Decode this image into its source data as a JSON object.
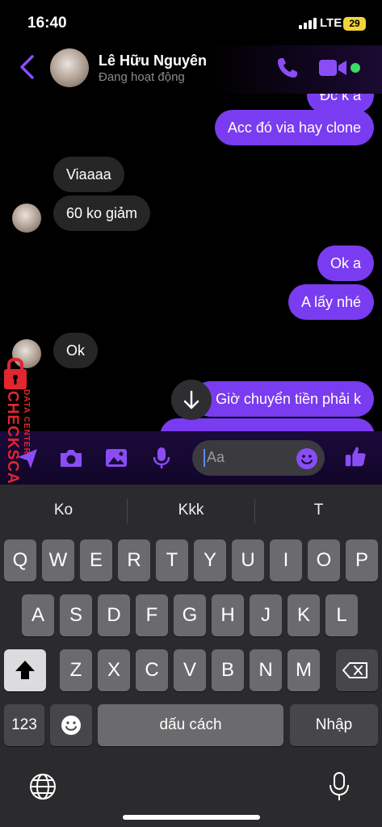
{
  "status_bar": {
    "time": "16:40",
    "network": "LTE",
    "battery": "29"
  },
  "header": {
    "contact_name": "Lê Hữu Nguyên",
    "presence": "Đang hoạt động"
  },
  "messages": [
    {
      "text": "Đc k a",
      "side": "out"
    },
    {
      "text": "Acc đó via hay clone",
      "side": "out"
    },
    {
      "text": "Viaaaa",
      "side": "in"
    },
    {
      "text": "60 ko giảm",
      "side": "in"
    },
    {
      "text": "Ok a",
      "side": "out"
    },
    {
      "text": "A lấy nhé",
      "side": "out"
    },
    {
      "text": "Ok",
      "side": "in"
    },
    {
      "text": "Giờ chuyển tiền phải k",
      "side": "out"
    }
  ],
  "composer": {
    "placeholder": "Aa"
  },
  "watermark": {
    "main": "CHECKSCAM.INFO",
    "sub": "DATA CENTER"
  },
  "keyboard": {
    "suggestions": [
      "Ko",
      "Kkk",
      "T"
    ],
    "row1": [
      "Q",
      "W",
      "E",
      "R",
      "T",
      "Y",
      "U",
      "I",
      "O",
      "P"
    ],
    "row2": [
      "A",
      "S",
      "D",
      "F",
      "G",
      "H",
      "J",
      "K",
      "L"
    ],
    "row3": [
      "Z",
      "X",
      "C",
      "V",
      "B",
      "N",
      "M"
    ],
    "numbers_key": "123",
    "space_key": "dấu cách",
    "return_key": "Nhập"
  },
  "colors": {
    "accent": "#7a3cf0",
    "incoming": "#262626",
    "online": "#3ddc64",
    "watermark": "#e0262f"
  }
}
